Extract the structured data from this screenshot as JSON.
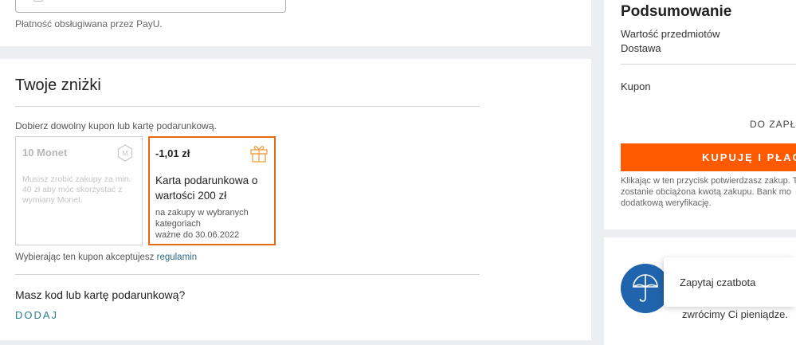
{
  "payment": {
    "note": "Płatność obsługiwana przez PayU."
  },
  "discounts": {
    "title": "Twoje zniżki",
    "choose_note": "Dobierz dowolny kupon lub kartę podarunkową.",
    "cards": [
      {
        "title": "10 Monet",
        "description": "Musisz zrobić zakupy za min. 40 zł aby móc skorzystać z wymiany Monet.",
        "icon": "monet-coin-icon",
        "disabled": true
      },
      {
        "title": "-1,01 zł",
        "main": "Karta podarunkowa o wartości 200 zł",
        "sub": "na zakupy w wybranych kategoriach",
        "valid": "ważne do 30.06.2022",
        "icon": "gift-icon",
        "selected": true
      }
    ],
    "terms_prefix": "Wybierając ten kupon akceptujesz ",
    "terms_link": "regulamin",
    "code_question": "Masz kod lub kartę podarunkową?",
    "add_label": "DODAJ"
  },
  "summary": {
    "title": "Podsumowanie",
    "items_label": "Wartość przedmiotów",
    "delivery_label": "Dostawa",
    "coupon_label": "Kupon",
    "to_pay_label": "DO ZAPŁA",
    "buy_label": "KUPUJĘ I PŁACĘ",
    "buy_note": "Klikając w ten przycisk potwierdzasz zakup. T\nzostanie obciążona kwotą zakupu. Bank mo\ndodatkową weryfikację."
  },
  "guarantee": {
    "refund_text": "zwrócimy Ci pieniądze.",
    "chat_label": "Zapytaj czatbota"
  },
  "colors": {
    "accent": "#ff5a00",
    "selected_border": "#e36a12",
    "link": "#2d7d8e",
    "umbrella_bg": "#1f64ad"
  }
}
